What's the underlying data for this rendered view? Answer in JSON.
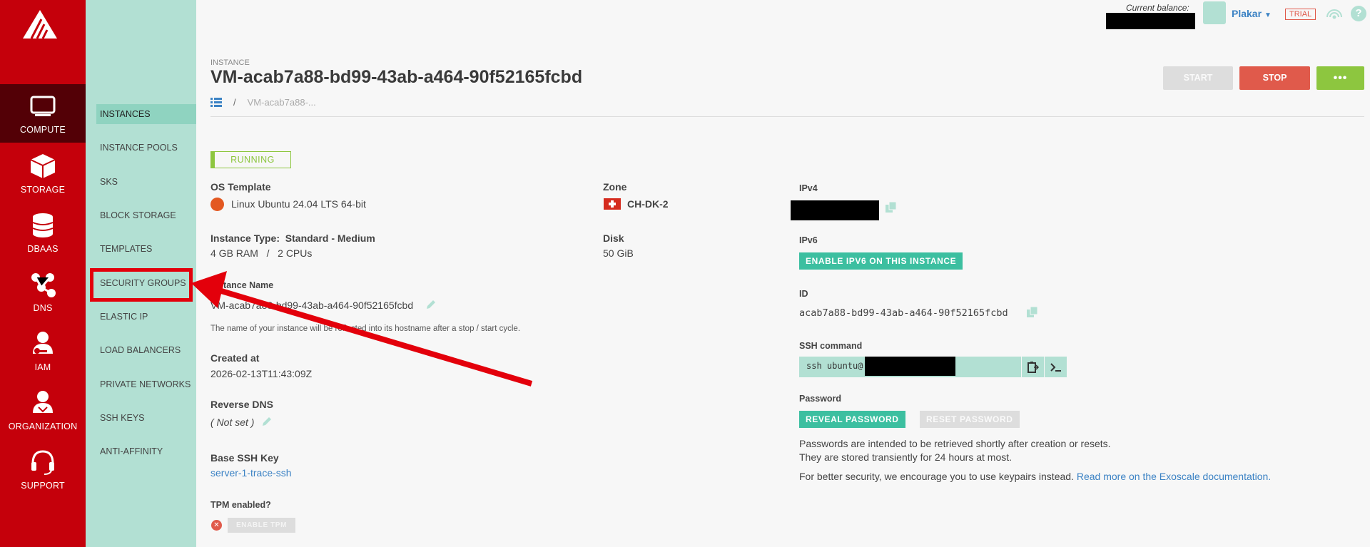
{
  "rail": {
    "items": [
      {
        "label": "COMPUTE",
        "icon": "monitor-icon"
      },
      {
        "label": "STORAGE",
        "icon": "box-icon"
      },
      {
        "label": "DBAAS",
        "icon": "database-icon"
      },
      {
        "label": "DNS",
        "icon": "network-icon"
      },
      {
        "label": "IAM",
        "icon": "user-key-icon"
      },
      {
        "label": "ORGANIZATION",
        "icon": "organization-icon"
      },
      {
        "label": "SUPPORT",
        "icon": "headset-icon"
      }
    ]
  },
  "subnav": {
    "items": [
      {
        "label": "INSTANCES"
      },
      {
        "label": "INSTANCE POOLS"
      },
      {
        "label": "SKS"
      },
      {
        "label": "BLOCK STORAGE"
      },
      {
        "label": "TEMPLATES"
      },
      {
        "label": "SECURITY GROUPS"
      },
      {
        "label": "ELASTIC IP"
      },
      {
        "label": "LOAD BALANCERS"
      },
      {
        "label": "PRIVATE NETWORKS"
      },
      {
        "label": "SSH KEYS"
      },
      {
        "label": "ANTI-AFFINITY"
      }
    ]
  },
  "topbar": {
    "balance_label": "Current balance:",
    "user": "Plakar",
    "trial": "TRIAL",
    "help": "?"
  },
  "header": {
    "section": "INSTANCE",
    "title": "VM-acab7a88-bd99-43ab-a464-90f52165fcbd",
    "breadcrumb_sep": "/",
    "breadcrumb_current": "VM-acab7a88-...",
    "start_label": "START",
    "stop_label": "STOP",
    "more_label": "•••"
  },
  "details": {
    "status": "RUNNING",
    "os_template_label": "OS Template",
    "os_template_value": "Linux Ubuntu 24.04 LTS 64-bit",
    "zone_label": "Zone",
    "zone_value": "CH-DK-2",
    "instance_type_label": "Instance Type:",
    "instance_type_value": "Standard - Medium",
    "ram": "4 GB RAM",
    "spec_sep": "/",
    "cpus": "2 CPUs",
    "disk_label": "Disk",
    "disk_value": "50 GiB",
    "instance_name_label": "Instance Name",
    "instance_name_value": "VM-acab7a88-bd99-43ab-a464-90f52165fcbd",
    "instance_name_help": "The name of your instance will be reflected into its hostname after a stop / start cycle.",
    "created_label": "Created at",
    "created_value": "2026-02-13T11:43:09Z",
    "rdns_label": "Reverse DNS",
    "rdns_value": "( Not set )",
    "ssh_key_label": "Base SSH Key",
    "ssh_key_value": "server-1-trace-ssh",
    "tpm_label": "TPM enabled?",
    "tpm_button": "ENABLE TPM",
    "tpm_x": "✕",
    "ipv4_label": "IPv4",
    "ipv6_label": "IPv6",
    "ipv6_button": "ENABLE IPV6 ON THIS INSTANCE",
    "id_label": "ID",
    "id_value": "acab7a88-bd99-43ab-a464-90f52165fcbd",
    "ssh_label": "SSH command",
    "ssh_value": "ssh ubuntu@",
    "password_label": "Password",
    "reveal_button": "REVEAL PASSWORD",
    "reset_button": "RESET PASSWORD",
    "password_note_1": "Passwords are intended to be retrieved shortly after creation or resets.",
    "password_note_2": "They are stored transiently for 24 hours at most.",
    "security_note": "For better security, we encourage you to use keypairs instead.",
    "security_link": "Read more on the Exoscale documentation."
  },
  "colors": {
    "rail": "#c5000b",
    "rail_active": "#530006",
    "subnav": "#b2e0d3",
    "teal": "#3cbfa0",
    "stop": "#e05a4b",
    "green": "#8dc63f",
    "annotation": "#e3000b"
  }
}
